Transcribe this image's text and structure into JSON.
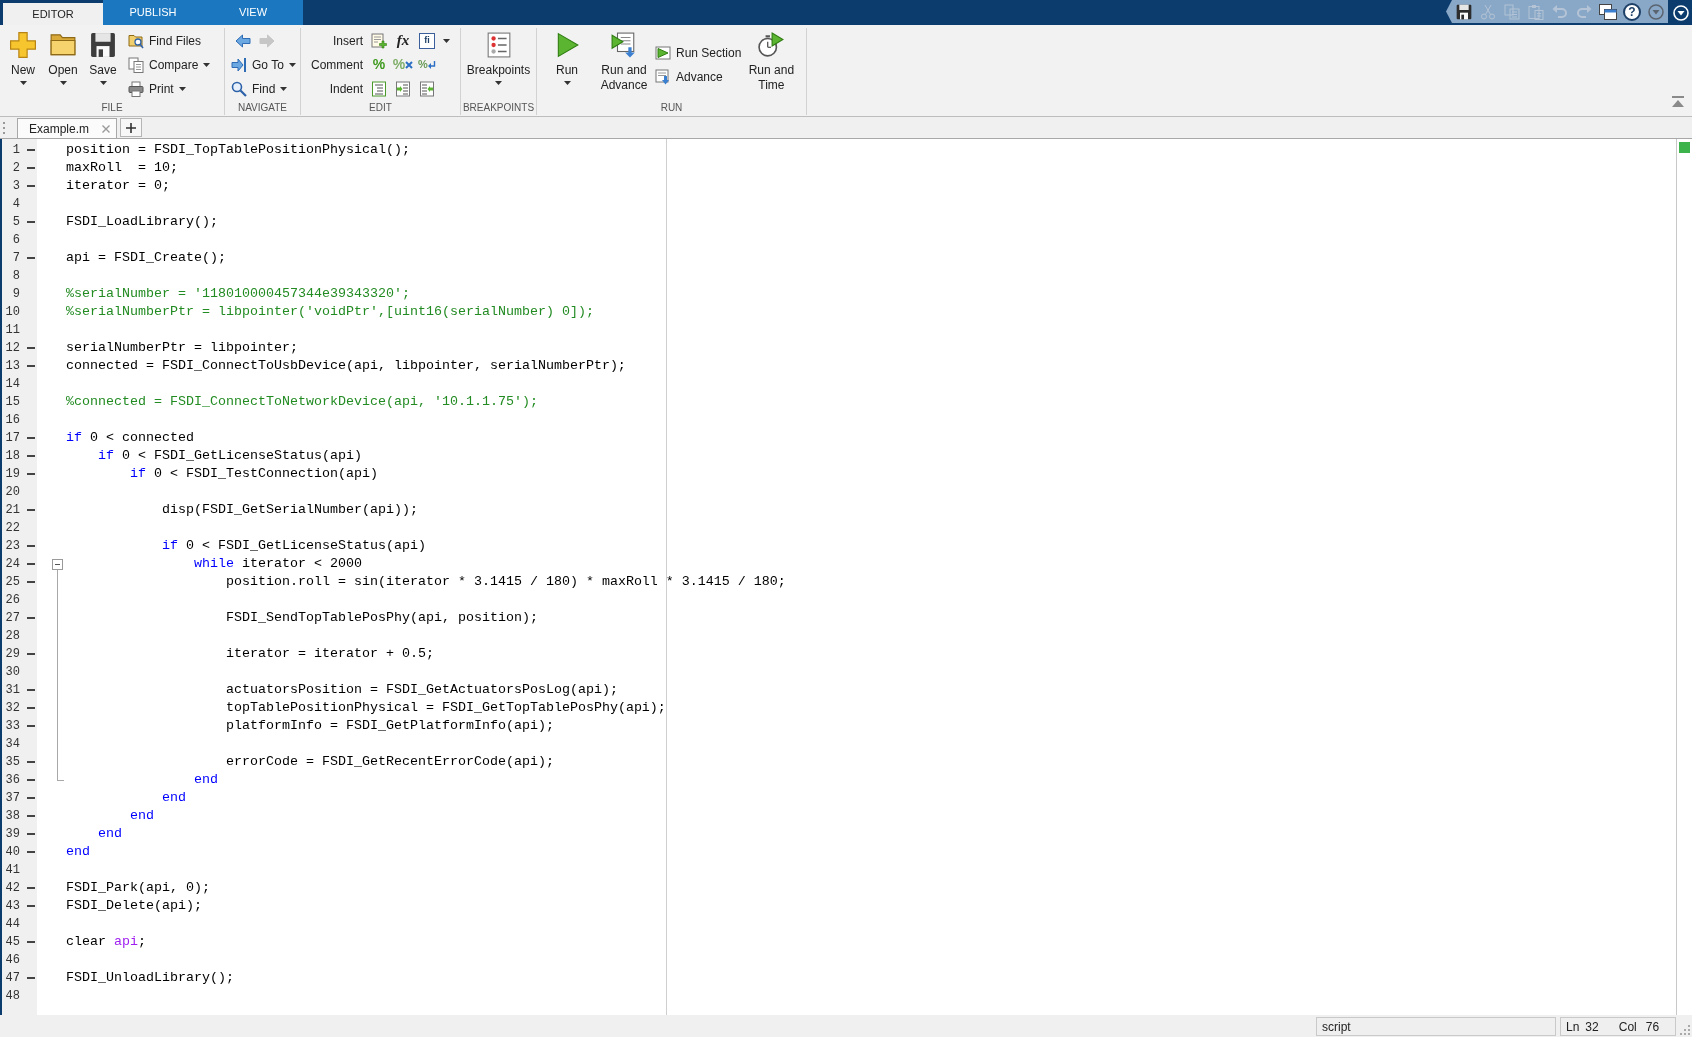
{
  "title_bar": {
    "tabs": [
      {
        "label": "EDITOR",
        "selected": true
      },
      {
        "label": "PUBLISH",
        "selected": false
      },
      {
        "label": "VIEW",
        "selected": false
      }
    ],
    "quick_access": [
      {
        "kind": "icon",
        "disabled": false
      },
      {
        "kind": "icon",
        "disabled": true
      },
      {
        "kind": "icon",
        "disabled": true
      },
      {
        "kind": "icon",
        "disabled": true
      },
      {
        "kind": "icon",
        "disabled": true
      },
      {
        "kind": "icon",
        "disabled": true
      },
      {
        "kind": "icon",
        "disabled": false
      },
      {
        "kind": "symbol",
        "symbol": "?",
        "disabled": false
      },
      {
        "kind": "icon",
        "disabled": false
      }
    ]
  },
  "toolstrip": {
    "groups": [
      {
        "label": "FILE",
        "items": [
          {
            "kind": "large",
            "label": "New",
            "dropdown": true
          },
          {
            "kind": "large",
            "label": "Open",
            "dropdown": true
          },
          {
            "kind": "large",
            "label": "Save",
            "dropdown": true
          },
          {
            "kind": "stack",
            "rows": [
              {
                "kind": "button",
                "label": "Find Files",
                "dropdown": false
              },
              {
                "kind": "button",
                "label": "Compare",
                "dropdown": true
              },
              {
                "kind": "button",
                "label": "Print",
                "dropdown": true
              }
            ]
          }
        ]
      },
      {
        "label": "NAVIGATE",
        "items": [
          {
            "kind": "stack",
            "rows": [
              {
                "kind": "icons",
                "buttons": [
                  {
                    "disabled": false
                  },
                  {
                    "disabled": true
                  }
                ]
              },
              {
                "kind": "button",
                "label": "Go To",
                "dropdown": true
              },
              {
                "kind": "button",
                "label": "Find",
                "dropdown": true
              }
            ]
          }
        ]
      },
      {
        "label": "EDIT",
        "items": [
          {
            "kind": "stack",
            "rows": [
              {
                "kind": "labeled",
                "label": "Insert",
                "dropdown": true,
                "buttons": [
                  {
                    "kind": "icon"
                  },
                  {
                    "kind": "symbol",
                    "symbol": "fx"
                  },
                  {
                    "kind": "symbol",
                    "symbol": "fi"
                  }
                ]
              },
              {
                "kind": "labeled",
                "label": "Comment",
                "dropdown": false,
                "buttons": [
                  {
                    "kind": "symbol",
                    "symbol": "%"
                  },
                  {
                    "kind": "symbol",
                    "symbol": "%"
                  },
                  {
                    "kind": "symbol",
                    "symbol": "%"
                  }
                ]
              },
              {
                "kind": "labeled",
                "label": "Indent",
                "dropdown": false,
                "buttons": [
                  {
                    "kind": "icon"
                  },
                  {
                    "kind": "icon"
                  },
                  {
                    "kind": "icon"
                  }
                ]
              }
            ]
          }
        ]
      },
      {
        "label": "BREAKPOINTS",
        "items": [
          {
            "kind": "large",
            "label": "Breakpoints",
            "dropdown": true
          }
        ]
      },
      {
        "label": "RUN",
        "items": [
          {
            "kind": "large",
            "label": "Run",
            "dropdown": true
          },
          {
            "kind": "large",
            "label": "Run and Advance",
            "dropdown": false
          },
          {
            "kind": "stack",
            "rows": [
              {
                "kind": "button",
                "label": "Run Section",
                "dropdown": false
              },
              {
                "kind": "button",
                "label": "Advance",
                "dropdown": false
              }
            ]
          },
          {
            "kind": "large",
            "label": "Run and Time",
            "dropdown": false
          }
        ]
      }
    ]
  },
  "document_tabs": [
    {
      "label": "Example.m",
      "selected": true
    }
  ],
  "editor": {
    "analyzer": {
      "warnings": false
    },
    "lines": [
      {
        "number": "1",
        "executable": true,
        "caret": false,
        "segments": [
          {
            "kind": "plain",
            "text": "position = FSDI_TopTablePositionPhysical();"
          }
        ]
      },
      {
        "number": "2",
        "executable": true,
        "caret": false,
        "segments": [
          {
            "kind": "plain",
            "text": "maxRoll  = 10;"
          }
        ]
      },
      {
        "number": "3",
        "executable": true,
        "caret": false,
        "segments": [
          {
            "kind": "plain",
            "text": "iterator = 0;"
          }
        ]
      },
      {
        "number": "4",
        "executable": false,
        "caret": false
      },
      {
        "number": "5",
        "executable": true,
        "caret": false,
        "segments": [
          {
            "kind": "plain",
            "text": "FSDI_LoadLibrary();"
          }
        ]
      },
      {
        "number": "6",
        "executable": false,
        "caret": false
      },
      {
        "number": "7",
        "executable": true,
        "caret": false,
        "segments": [
          {
            "kind": "plain",
            "text": "api = FSDI_Create();"
          }
        ]
      },
      {
        "number": "8",
        "executable": false,
        "caret": false
      },
      {
        "number": "9",
        "executable": false,
        "caret": false,
        "segments": [
          {
            "kind": "comment",
            "text": "%serialNumber = '118010000457344e39343320';"
          }
        ]
      },
      {
        "number": "10",
        "executable": false,
        "caret": false,
        "segments": [
          {
            "kind": "comment",
            "text": "%serialNumberPtr = libpointer('voidPtr',[uint16(serialNumber) 0]);"
          }
        ]
      },
      {
        "number": "11",
        "executable": false,
        "caret": false
      },
      {
        "number": "12",
        "executable": true,
        "caret": false,
        "segments": [
          {
            "kind": "plain",
            "text": "serialNumberPtr = libpointer;"
          }
        ]
      },
      {
        "number": "13",
        "executable": true,
        "caret": false,
        "segments": [
          {
            "kind": "plain",
            "text": "connected = FSDI_ConnectToUsbDevice(api, libpointer, serialNumberPtr);"
          }
        ]
      },
      {
        "number": "14",
        "executable": false,
        "caret": false
      },
      {
        "number": "15",
        "executable": false,
        "caret": false,
        "segments": [
          {
            "kind": "comment",
            "text": "%connected = FSDI_ConnectToNetworkDevice(api, '10.1.1.75');"
          }
        ]
      },
      {
        "number": "16",
        "executable": false,
        "caret": false
      },
      {
        "number": "17",
        "executable": true,
        "caret": false,
        "segments": [
          {
            "kind": "keyword",
            "text": "if"
          },
          {
            "kind": "plain",
            "text": " 0 < connected"
          }
        ]
      },
      {
        "number": "18",
        "executable": true,
        "caret": false,
        "segments": [
          {
            "kind": "keyword",
            "text": "    if"
          },
          {
            "kind": "plain",
            "text": " 0 < FSDI_GetLicenseStatus(api)"
          }
        ]
      },
      {
        "number": "19",
        "executable": true,
        "caret": false,
        "segments": [
          {
            "kind": "keyword",
            "text": "        if"
          },
          {
            "kind": "plain",
            "text": " 0 < FSDI_TestConnection(api)"
          }
        ]
      },
      {
        "number": "20",
        "executable": false,
        "caret": false
      },
      {
        "number": "21",
        "executable": true,
        "caret": false,
        "segments": [
          {
            "kind": "plain",
            "text": "            disp(FSDI_GetSerialNumber(api));"
          }
        ]
      },
      {
        "number": "22",
        "executable": false,
        "caret": false
      },
      {
        "number": "23",
        "executable": true,
        "caret": false,
        "segments": [
          {
            "kind": "keyword",
            "text": "            if"
          },
          {
            "kind": "plain",
            "text": " 0 < FSDI_GetLicenseStatus(api)"
          }
        ]
      },
      {
        "number": "24",
        "executable": true,
        "caret": false,
        "fold": {
          "expanded": true
        },
        "segments": [
          {
            "kind": "keyword",
            "text": "                while"
          },
          {
            "kind": "plain",
            "text": " iterator < 2000"
          }
        ]
      },
      {
        "number": "25",
        "executable": true,
        "caret": false,
        "segments": [
          {
            "kind": "plain",
            "text": "                    position.roll = sin(iterator * 3.1415 / 180) * maxRoll * 3.1415 / 180;"
          }
        ]
      },
      {
        "number": "26",
        "executable": false,
        "caret": false
      },
      {
        "number": "27",
        "executable": true,
        "caret": false,
        "segments": [
          {
            "kind": "plain",
            "text": "                    FSDI_SendTopTablePosPhy(api, position);"
          }
        ]
      },
      {
        "number": "28",
        "executable": false,
        "caret": false
      },
      {
        "number": "29",
        "executable": true,
        "caret": false,
        "segments": [
          {
            "kind": "plain",
            "text": "                    iterator = iterator + 0.5;"
          }
        ]
      },
      {
        "number": "30",
        "executable": false,
        "caret": false
      },
      {
        "number": "31",
        "executable": true,
        "caret": false,
        "segments": [
          {
            "kind": "plain",
            "text": "                    actuatorsPosition = FSDI_GetActuatorsPosLog(api);"
          }
        ]
      },
      {
        "number": "32",
        "executable": true,
        "caret": true,
        "segments": [
          {
            "kind": "plain",
            "text": "                    topTablePositionPhysical = FSDI_GetTopTablePosPhy(api);"
          }
        ]
      },
      {
        "number": "33",
        "executable": true,
        "caret": false,
        "segments": [
          {
            "kind": "plain",
            "text": "                    platformInfo = FSDI_GetPlatformInfo(api);"
          }
        ]
      },
      {
        "number": "34",
        "executable": false,
        "caret": false
      },
      {
        "number": "35",
        "executable": true,
        "caret": false,
        "segments": [
          {
            "kind": "plain",
            "text": "                    errorCode = FSDI_GetRecentErrorCode(api);"
          }
        ]
      },
      {
        "number": "36",
        "executable": true,
        "caret": false,
        "segments": [
          {
            "kind": "keyword",
            "text": "                end"
          }
        ]
      },
      {
        "number": "37",
        "executable": true,
        "caret": false,
        "segments": [
          {
            "kind": "keyword",
            "text": "            end"
          }
        ]
      },
      {
        "number": "38",
        "executable": true,
        "caret": false,
        "segments": [
          {
            "kind": "keyword",
            "text": "        end"
          }
        ]
      },
      {
        "number": "39",
        "executable": true,
        "caret": false,
        "segments": [
          {
            "kind": "keyword",
            "text": "    end"
          }
        ]
      },
      {
        "number": "40",
        "executable": true,
        "caret": false,
        "segments": [
          {
            "kind": "keyword",
            "text": "end"
          }
        ]
      },
      {
        "number": "41",
        "executable": false,
        "caret": false
      },
      {
        "number": "42",
        "executable": true,
        "caret": false,
        "segments": [
          {
            "kind": "plain",
            "text": "FSDI_Park(api, 0);"
          }
        ]
      },
      {
        "number": "43",
        "executable": true,
        "caret": false,
        "segments": [
          {
            "kind": "plain",
            "text": "FSDI_Delete(api);"
          }
        ]
      },
      {
        "number": "44",
        "executable": false,
        "caret": false
      },
      {
        "number": "45",
        "executable": true,
        "caret": false,
        "segments": [
          {
            "kind": "plain",
            "text": "clear "
          },
          {
            "kind": "string",
            "text": "api"
          },
          {
            "kind": "plain",
            "text": ";"
          }
        ]
      },
      {
        "number": "46",
        "executable": false,
        "caret": false
      },
      {
        "number": "47",
        "executable": true,
        "caret": false,
        "segments": [
          {
            "kind": "plain",
            "text": "FSDI_UnloadLibrary();"
          }
        ]
      },
      {
        "number": "48",
        "executable": false,
        "caret": false
      }
    ]
  },
  "status_bar": {
    "file_type": "script",
    "line_label": "Ln",
    "line": "32",
    "column_label": "Col",
    "column": "76"
  }
}
